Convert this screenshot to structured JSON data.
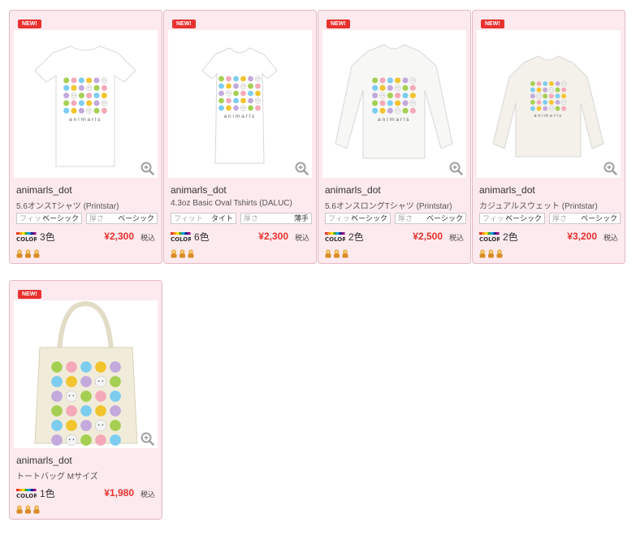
{
  "badge": "NEW!",
  "spec_labels": {
    "fit": "フィット",
    "thickness": "厚さ"
  },
  "tax_label": "税込",
  "color_logo_text": "COLOR:",
  "products": [
    {
      "name": "animarls_dot",
      "type": "5.6オンスTシャツ (Printstar)",
      "fit": "ベーシック",
      "thickness": "ベーシック",
      "colors": "3色",
      "price": "¥2,300",
      "shape": "tshirt"
    },
    {
      "name": "animarls_dot",
      "type": "4.3oz Basic Oval Tshirts (DALUC)",
      "fit": "タイト",
      "thickness": "薄手",
      "colors": "6色",
      "price": "¥2,300",
      "shape": "oval"
    },
    {
      "name": "animarls_dot",
      "type": "5.6オンスロングTシャツ (Printstar)",
      "fit": "ベーシック",
      "thickness": "ベーシック",
      "colors": "2色",
      "price": "¥2,500",
      "shape": "longsleeve"
    },
    {
      "name": "animarls_dot",
      "type": "カジュアルスウェット (Printstar)",
      "fit": "ベーシック",
      "thickness": "ベーシック",
      "colors": "2色",
      "price": "¥3,200",
      "shape": "sweat"
    },
    {
      "name": "animarls_dot",
      "type": "トートバッグ Mサイズ",
      "colors": "1色",
      "price": "¥1,980",
      "shape": "tote"
    }
  ],
  "print_text": "animarls",
  "colors": {
    "accent": "#e8322f",
    "card_bg": "#fdeaee",
    "card_border": "#e3b9c2"
  }
}
